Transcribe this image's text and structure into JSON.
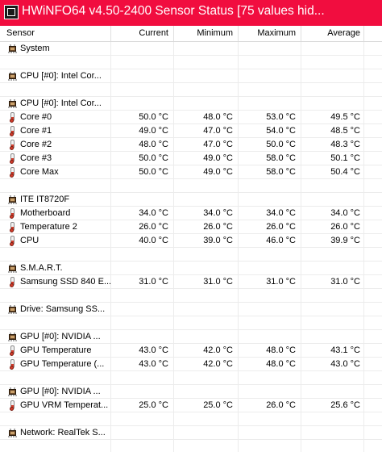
{
  "window": {
    "title": "HWiNFO64 v4.50-2400 Sensor Status [75 values hid..."
  },
  "columns": {
    "sensor": "Sensor",
    "current": "Current",
    "minimum": "Minimum",
    "maximum": "Maximum",
    "average": "Average"
  },
  "rows": [
    {
      "type": "group",
      "label": "System"
    },
    {
      "type": "blank"
    },
    {
      "type": "group",
      "label": "CPU [#0]: Intel Cor..."
    },
    {
      "type": "blank"
    },
    {
      "type": "group",
      "label": "CPU [#0]: Intel Cor..."
    },
    {
      "type": "temp",
      "label": "Core #0",
      "current": "50.0 °C",
      "minimum": "48.0 °C",
      "maximum": "53.0 °C",
      "average": "49.5 °C"
    },
    {
      "type": "temp",
      "label": "Core #1",
      "current": "49.0 °C",
      "minimum": "47.0 °C",
      "maximum": "54.0 °C",
      "average": "48.5 °C"
    },
    {
      "type": "temp",
      "label": "Core #2",
      "current": "48.0 °C",
      "minimum": "47.0 °C",
      "maximum": "50.0 °C",
      "average": "48.3 °C"
    },
    {
      "type": "temp",
      "label": "Core #3",
      "current": "50.0 °C",
      "minimum": "49.0 °C",
      "maximum": "58.0 °C",
      "average": "50.1 °C"
    },
    {
      "type": "temp",
      "label": "Core Max",
      "current": "50.0 °C",
      "minimum": "49.0 °C",
      "maximum": "58.0 °C",
      "average": "50.4 °C"
    },
    {
      "type": "blank"
    },
    {
      "type": "group",
      "label": "ITE IT8720F"
    },
    {
      "type": "temp",
      "label": "Motherboard",
      "current": "34.0 °C",
      "minimum": "34.0 °C",
      "maximum": "34.0 °C",
      "average": "34.0 °C"
    },
    {
      "type": "temp",
      "label": "Temperature 2",
      "current": "26.0 °C",
      "minimum": "26.0 °C",
      "maximum": "26.0 °C",
      "average": "26.0 °C"
    },
    {
      "type": "temp",
      "label": "CPU",
      "current": "40.0 °C",
      "minimum": "39.0 °C",
      "maximum": "46.0 °C",
      "average": "39.9 °C"
    },
    {
      "type": "blank"
    },
    {
      "type": "group",
      "label": "S.M.A.R.T."
    },
    {
      "type": "temp",
      "label": "Samsung SSD 840 E...",
      "current": "31.0 °C",
      "minimum": "31.0 °C",
      "maximum": "31.0 °C",
      "average": "31.0 °C"
    },
    {
      "type": "blank"
    },
    {
      "type": "group",
      "label": "Drive: Samsung SS..."
    },
    {
      "type": "blank"
    },
    {
      "type": "group",
      "label": "GPU [#0]: NVIDIA ..."
    },
    {
      "type": "temp",
      "label": "GPU Temperature",
      "current": "43.0 °C",
      "minimum": "42.0 °C",
      "maximum": "48.0 °C",
      "average": "43.1 °C"
    },
    {
      "type": "temp",
      "label": "GPU Temperature (...",
      "current": "43.0 °C",
      "minimum": "42.0 °C",
      "maximum": "48.0 °C",
      "average": "43.0 °C"
    },
    {
      "type": "blank"
    },
    {
      "type": "group",
      "label": "GPU [#0]: NVIDIA ..."
    },
    {
      "type": "temp",
      "label": "GPU VRM Temperat...",
      "current": "25.0 °C",
      "minimum": "25.0 °C",
      "maximum": "26.0 °C",
      "average": "25.6 °C"
    },
    {
      "type": "blank"
    },
    {
      "type": "group",
      "label": "Network: RealTek S..."
    },
    {
      "type": "blank"
    }
  ],
  "icons": {
    "app": "hwinfo-app-icon",
    "group": "chip-icon",
    "sensor": "thermometer-icon"
  },
  "colors": {
    "titlebar": "#f10d3f",
    "thermometer": "#d23b2a"
  }
}
